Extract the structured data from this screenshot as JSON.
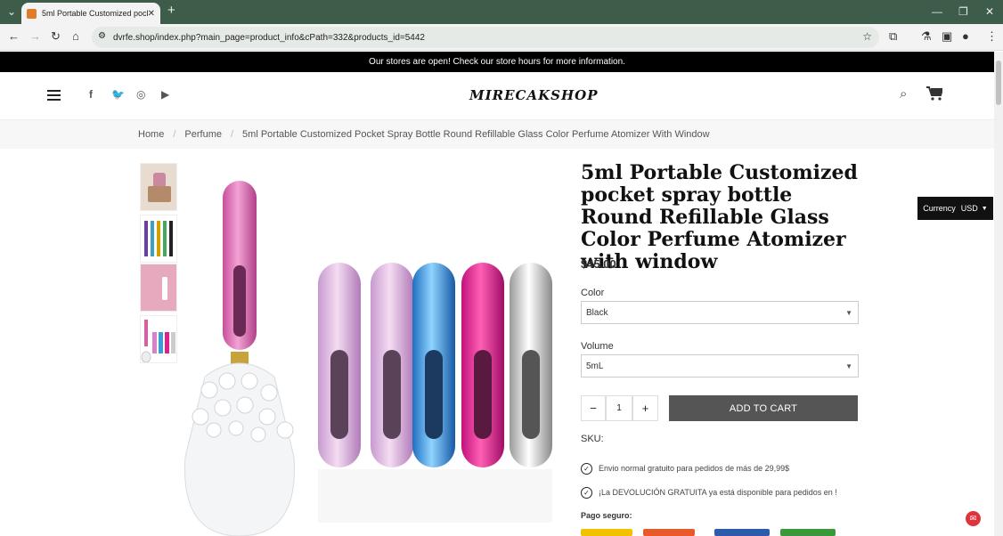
{
  "browser": {
    "tab_title": "5ml Portable Customized pock...",
    "url": "dvrfe.shop/index.php?main_page=product_info&cPath=332&products_id=5442"
  },
  "announcement": "Our stores are open! Check our store hours for more information.",
  "header": {
    "logo": "MIRECAKSHOP"
  },
  "breadcrumb": [
    "Home",
    "Perfume",
    "5ml Portable Customized Pocket Spray Bottle Round Refillable Glass Color Perfume Atomizer With Window"
  ],
  "product": {
    "title": "5ml Portable Customized pocket spray bottle Round Refillable Glass Color Perfume Atomizer with window",
    "price": "$45.00",
    "color_label": "Color",
    "color_value": "Black",
    "volume_label": "Volume",
    "volume_value": "5mL",
    "qty": "1",
    "add_to_cart": "ADD TO CART",
    "sku_label": "SKU:",
    "shipping_note": "Envio normal gratuito para pedidos de más de 29,99$",
    "return_note": "¡La DEVOLUCIÓN GRATUITA ya está disponible para pedidos en !",
    "secure_payment": "Pago seguro:"
  },
  "currency": {
    "label": "Currency",
    "value": "USD"
  },
  "colors": {
    "tabbar": "#3d5c4a",
    "cart_button": "#555555"
  }
}
